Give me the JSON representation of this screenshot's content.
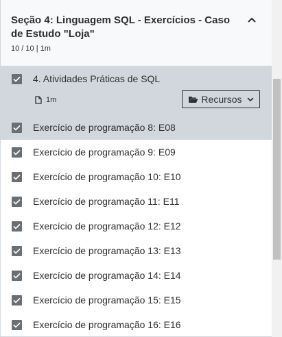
{
  "section": {
    "title": "Seção 4: Linguagem SQL - Exercícios - Caso de Estudo \"Loja\"",
    "meta": "10 / 10 | 1m",
    "collapse_icon": "chevron-up-icon"
  },
  "first_item": {
    "label": "4. Atividades Práticas de SQL",
    "checked": true,
    "duration": "1m",
    "duration_icon": "file-icon",
    "resources_label": "Recursos",
    "resources_icon": "folder-open-icon"
  },
  "items": [
    {
      "label": "Exercício de programação 8: E08",
      "checked": true
    },
    {
      "label": "Exercício de programação 9: E09",
      "checked": true
    },
    {
      "label": "Exercício de programação 10: E10",
      "checked": true
    },
    {
      "label": "Exercício de programação 11: E11",
      "checked": true
    },
    {
      "label": "Exercício de programação 12: E12",
      "checked": true
    },
    {
      "label": "Exercício de programação 13: E13",
      "checked": true
    },
    {
      "label": "Exercício de programação 14: E14",
      "checked": true
    },
    {
      "label": "Exercício de programação 15: E15",
      "checked": true
    },
    {
      "label": "Exercício de programação 16: E16",
      "checked": true
    }
  ],
  "colors": {
    "active_bg": "#d1d7dc",
    "header_bg": "#f7f9fa",
    "checkbox": "#6a6f73",
    "text": "#2d2f31"
  }
}
